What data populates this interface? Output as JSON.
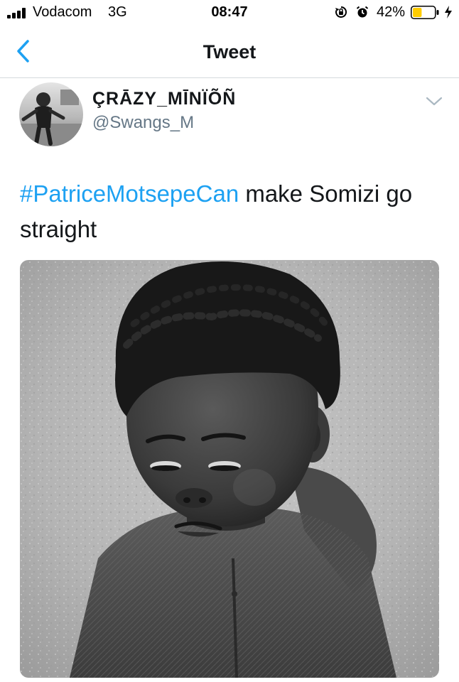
{
  "status_bar": {
    "carrier": "Vodacom",
    "network": "3G",
    "time": "08:47",
    "battery_percent": "42%",
    "battery_level": 0.42,
    "battery_color": "#ffcc00",
    "icons": [
      "signal-icon",
      "rotation-lock-icon",
      "alarm-icon",
      "battery-icon",
      "charging-icon"
    ]
  },
  "nav": {
    "title": "Tweet",
    "back_icon": "chevron-left-icon",
    "accent_color": "#1da1f2"
  },
  "tweet": {
    "author": {
      "display_name": "ÇRĀZY_MĪNÏÕÑ",
      "handle": "@Swangs_M"
    },
    "caret_icon": "chevron-down-icon",
    "text": {
      "hashtag": "#PatriceMotsepeCan",
      "body": " make Somizi go straight"
    },
    "media_icon": "photo-toddler-frowning"
  }
}
